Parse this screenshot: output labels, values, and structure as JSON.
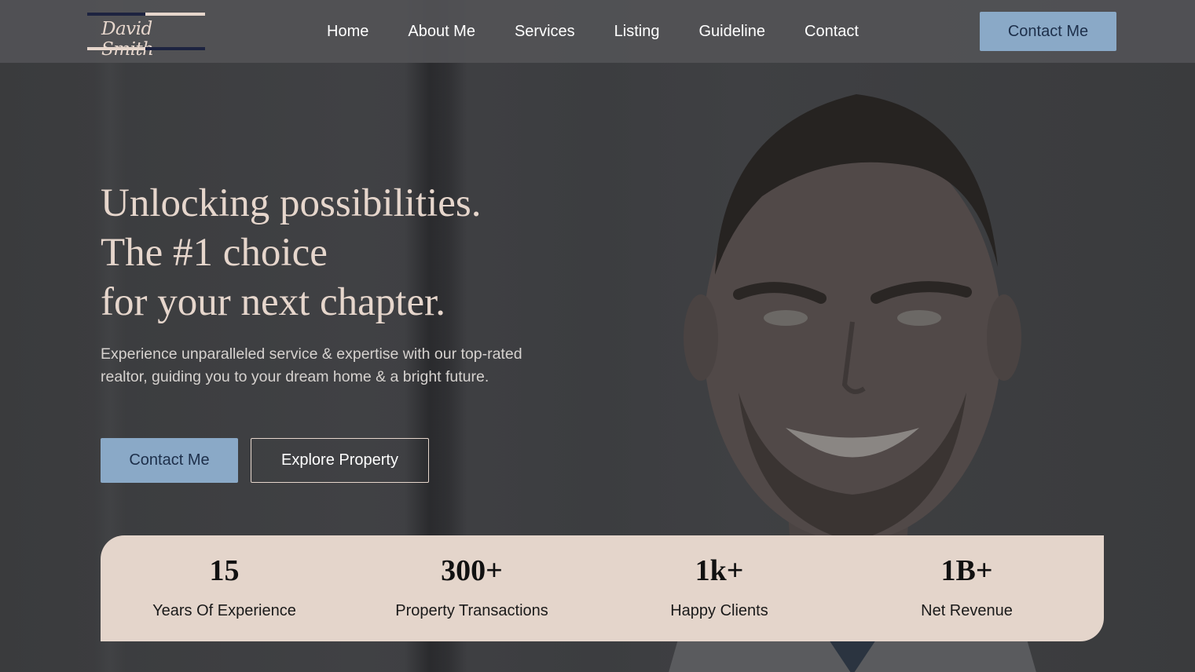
{
  "brand": {
    "logo_text": "David Smith"
  },
  "nav": {
    "links": [
      "Home",
      "About Me",
      "Services",
      "Listing",
      "Guideline",
      "Contact"
    ],
    "cta_label": "Contact Me"
  },
  "hero": {
    "title_lines": [
      "Unlocking possibilities.",
      "The #1 choice",
      "for your next chapter."
    ],
    "subtitle": "Experience unparalleled service & expertise with our top-rated realtor, guiding you to your dream home & a bright future.",
    "primary_button": "Contact Me",
    "secondary_button": "Explore Property"
  },
  "stats": [
    {
      "value": "15",
      "label": "Years Of Experience"
    },
    {
      "value": "300+",
      "label": "Property Transactions"
    },
    {
      "value": "1k+",
      "label": "Happy Clients"
    },
    {
      "value": "1B+",
      "label": "Net Revenue"
    }
  ],
  "colors": {
    "accent": "#8aa9c7",
    "cream": "#e4d5cb",
    "navy": "#1d2340",
    "overlay": "#3b3c3e"
  }
}
